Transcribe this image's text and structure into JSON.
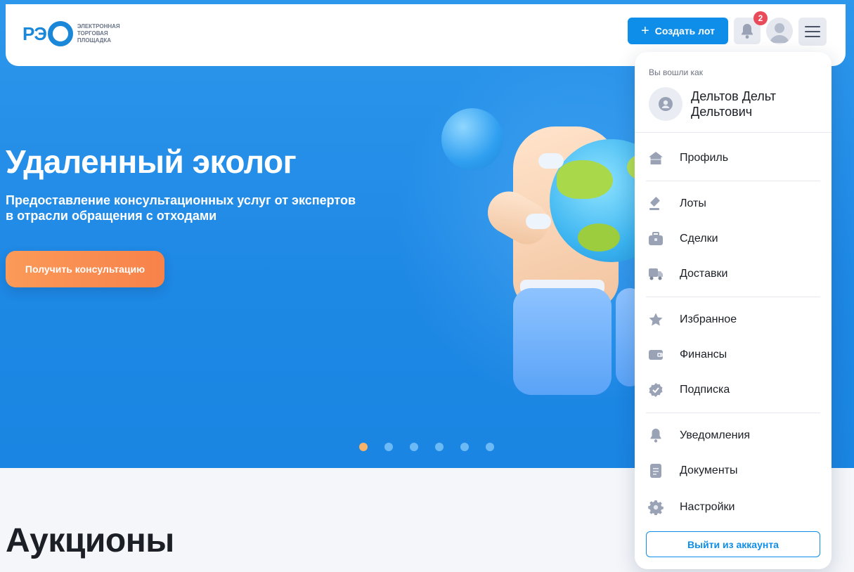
{
  "header": {
    "logo_mark": "РЭ",
    "logo_lines": [
      "ЭЛЕКТРОННАЯ",
      "ТОРГОВАЯ",
      "ПЛОЩАДКА"
    ],
    "create_lot_label": "Создать лот",
    "notifications_count": "2"
  },
  "hero": {
    "title": "Удаленный эколог",
    "subtitle_line1": "Предоставление консультационных услуг от экспертов",
    "subtitle_line2": "в отрасли обращения с отходами",
    "cta_label": "Получить консультацию",
    "slides_total": 6,
    "active_slide": 1
  },
  "section": {
    "title": "Аукционы"
  },
  "account_menu": {
    "caption": "Вы вошли как",
    "user_name_line1": "Дельтов Дельт",
    "user_name_line2": "Дельтович",
    "items": [
      {
        "label": "Профиль",
        "icon": "home-icon"
      },
      {
        "label": "Лоты",
        "icon": "gavel-icon"
      },
      {
        "label": "Сделки",
        "icon": "briefcase-icon"
      },
      {
        "label": "Доставки",
        "icon": "truck-icon"
      },
      {
        "label": "Избранное",
        "icon": "star-icon"
      },
      {
        "label": "Финансы",
        "icon": "wallet-icon"
      },
      {
        "label": "Подписка",
        "icon": "verified-badge-icon"
      },
      {
        "label": "Уведомления",
        "icon": "bell-icon"
      },
      {
        "label": "Документы",
        "icon": "document-icon"
      },
      {
        "label": "Настройки",
        "icon": "gear-icon"
      }
    ],
    "logout_label": "Выйти из аккаунта"
  },
  "colors": {
    "primary": "#0f8ee9",
    "hero_bg": "#1e88e5",
    "cta": "#f7824a",
    "badge": "#ea4b5b",
    "icon_gray": "#9aa3b5"
  }
}
